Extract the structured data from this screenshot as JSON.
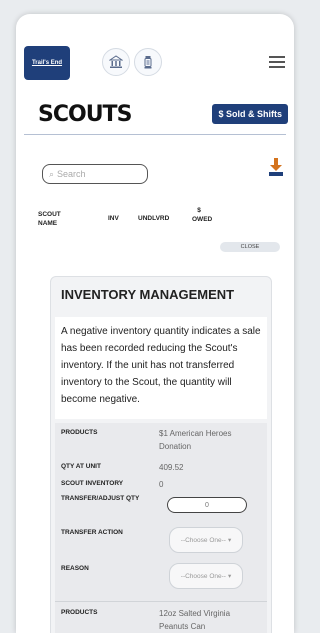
{
  "header": {
    "logo_text": "Trail's End",
    "page_title": "SCOUTS",
    "sold_button_label": "$ Sold & Shifts",
    "icons": [
      "bank-icon",
      "lantern-icon",
      "menu-icon"
    ]
  },
  "search": {
    "placeholder": "Search"
  },
  "table": {
    "columns": [
      "SCOUT NAME",
      "INV",
      "UNDLVRD",
      "$ OWED"
    ],
    "sort_chip": "CLOSE"
  },
  "inventory_card": {
    "title": "INVENTORY MANAGEMENT",
    "message": "A negative inventory quantity indicates a sale has been recorded reducing the Scout's inventory. If the unit has not transferred inventory to the Scout, the quantity will become negative.",
    "labels": {
      "products": "PRODUCTS",
      "qty_at_unit": "QTY AT UNIT",
      "scout_inventory": "SCOUT INVENTORY",
      "transfer_adjust_qty": "TRANSFER/ADJUST QTY",
      "transfer_action": "TRANSFER ACTION",
      "reason": "REASON"
    },
    "rows": [
      {
        "product": "$1 American Heroes Donation",
        "qty_at_unit": "409.52",
        "scout_inventory": "0",
        "transfer_qty": "0",
        "transfer_action": "--Choose One--",
        "reason": "--Choose One--"
      },
      {
        "product": "12oz Salted Virginia Peanuts Can"
      }
    ]
  },
  "colors": {
    "brand": "#1f3f7a"
  }
}
